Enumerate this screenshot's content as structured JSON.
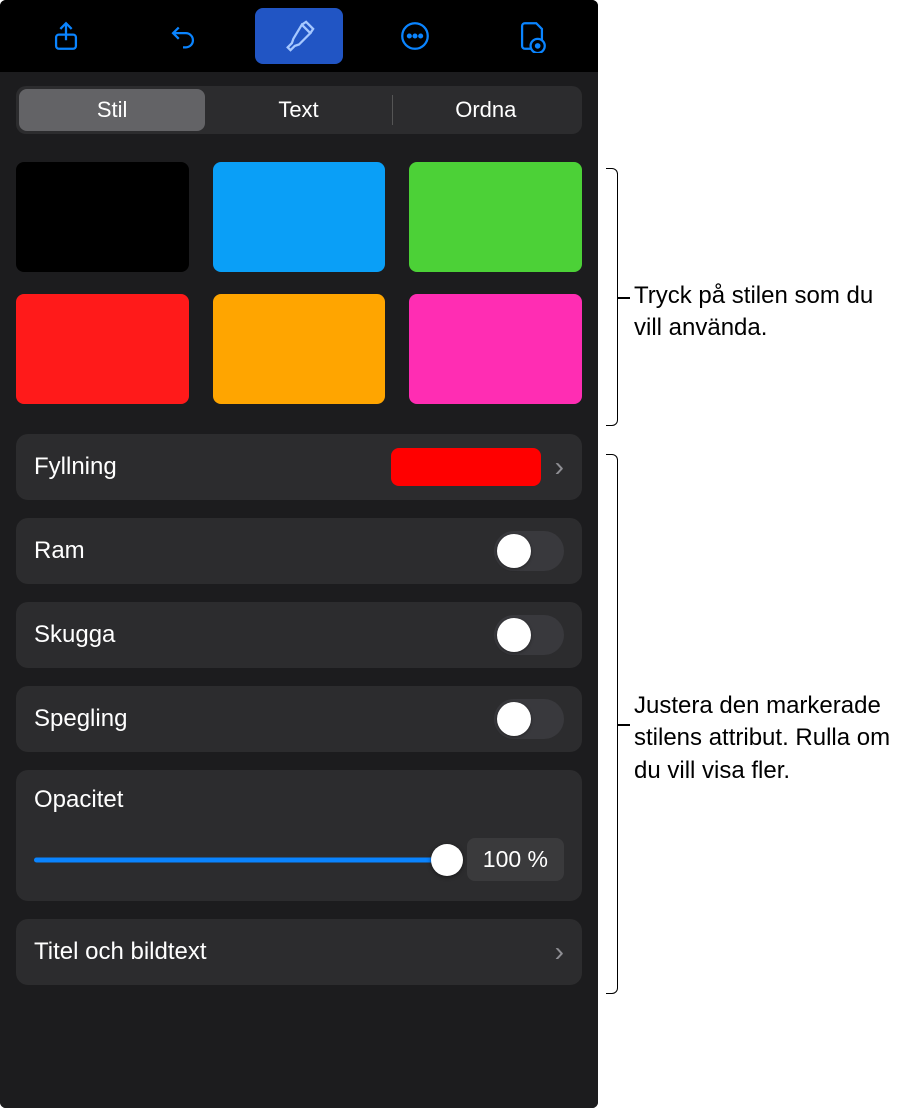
{
  "toolbar": {
    "share_icon": "share-icon",
    "undo_icon": "undo-icon",
    "brush_icon": "brush-icon",
    "more_icon": "more-icon",
    "doc_icon": "doc-insert-icon"
  },
  "tabs": {
    "items": [
      {
        "label": "Stil",
        "selected": true
      },
      {
        "label": "Text",
        "selected": false
      },
      {
        "label": "Ordna",
        "selected": false
      }
    ]
  },
  "swatches": [
    {
      "color": "#000000"
    },
    {
      "color": "#0a9ff7"
    },
    {
      "color": "#4cd137"
    },
    {
      "color": "#ff1a1a"
    },
    {
      "color": "#ffa500"
    },
    {
      "color": "#ff2db3"
    }
  ],
  "rows": {
    "fill": {
      "label": "Fyllning",
      "chip_color": "#ff0000"
    },
    "border": {
      "label": "Ram",
      "on": false
    },
    "shadow": {
      "label": "Skugga",
      "on": false
    },
    "reflection": {
      "label": "Spegling",
      "on": false
    },
    "opacity": {
      "label": "Opacitet",
      "value_text": "100 %",
      "value": 100
    },
    "title_caption": {
      "label": "Titel och bildtext"
    }
  },
  "callouts": {
    "swatches": "Tryck på stilen som du vill använda.",
    "attributes": "Justera den markerade stilens attribut. Rulla om du vill visa fler."
  }
}
